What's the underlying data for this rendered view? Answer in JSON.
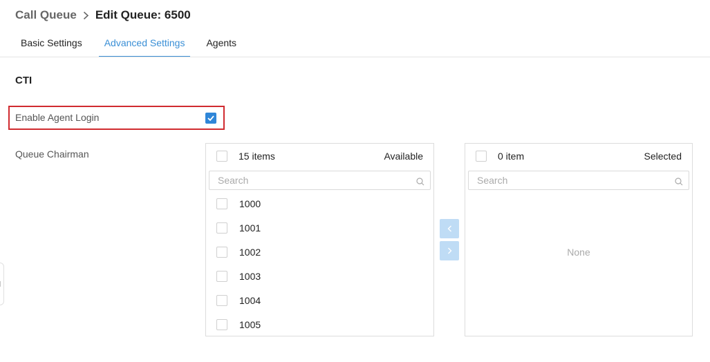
{
  "breadcrumb": {
    "parent": "Call Queue",
    "separator": ">",
    "current": "Edit Queue: 6500"
  },
  "tabs": [
    {
      "label": "Basic Settings",
      "active": false
    },
    {
      "label": "Advanced Settings",
      "active": true
    },
    {
      "label": "Agents",
      "active": false
    }
  ],
  "section": {
    "title": "CTI"
  },
  "enable_agent_login": {
    "label": "Enable Agent Login",
    "checked": true
  },
  "queue_chairman": {
    "label": "Queue Chairman",
    "available": {
      "count_label": "15 items",
      "title": "Available",
      "search_placeholder": "Search",
      "items": [
        "1000",
        "1001",
        "1002",
        "1003",
        "1004",
        "1005"
      ]
    },
    "selected": {
      "count_label": "0 item",
      "title": "Selected",
      "search_placeholder": "Search",
      "empty_text": "None"
    },
    "move_left_icon": "chevron-left-icon",
    "move_right_icon": "chevron-right-icon"
  },
  "colors": {
    "accent": "#3a8fd6",
    "highlight_border": "#d02a2f",
    "transfer_button_disabled": "#bfdcf5"
  }
}
